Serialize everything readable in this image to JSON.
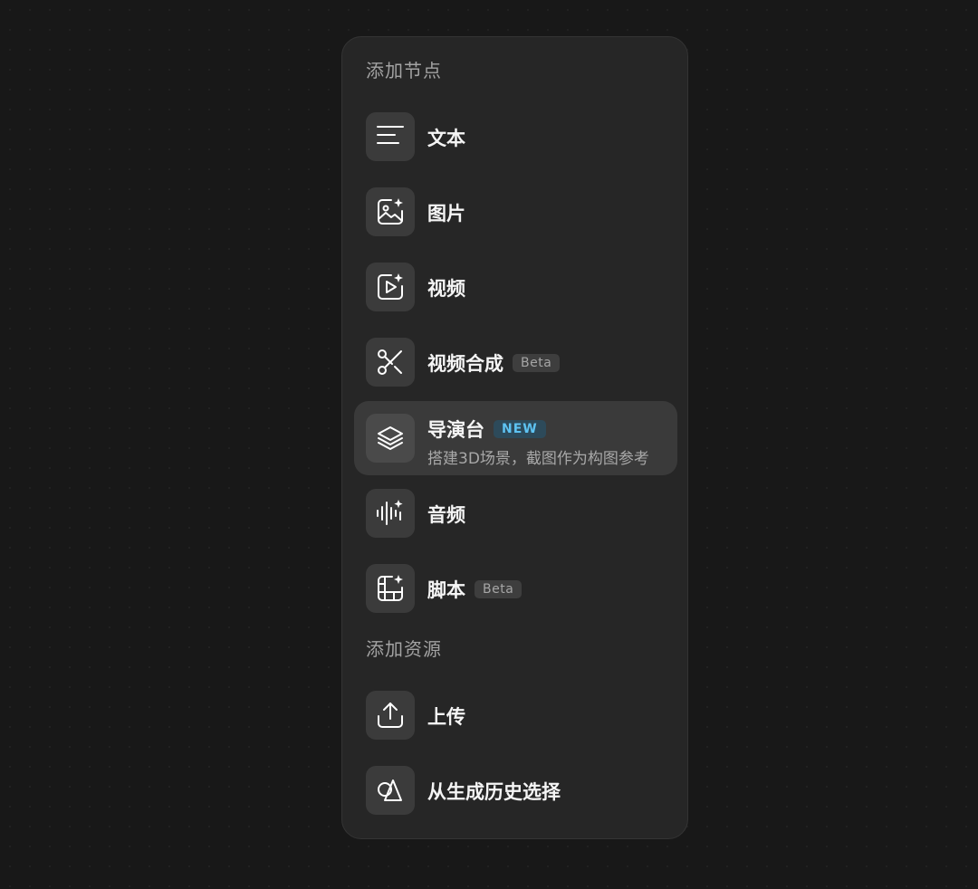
{
  "menu": {
    "nodes_section_title": "添加节点",
    "resources_section_title": "添加资源",
    "nodes": [
      {
        "label": "文本",
        "icon": "text-lines-icon"
      },
      {
        "label": "图片",
        "icon": "image-sparkle-icon"
      },
      {
        "label": "视频",
        "icon": "video-sparkle-icon"
      },
      {
        "label": "视频合成",
        "badge": "Beta",
        "icon": "scissors-icon"
      },
      {
        "label": "导演台",
        "badge": "NEW",
        "subtitle": "搭建3D场景，截图作为构图参考",
        "icon": "layers-icon"
      },
      {
        "label": "音频",
        "icon": "audio-wave-icon"
      },
      {
        "label": "脚本",
        "badge": "Beta",
        "icon": "storyboard-icon"
      }
    ],
    "resources": [
      {
        "label": "上传",
        "icon": "upload-icon"
      },
      {
        "label": "从生成历史选择",
        "icon": "shapes-icon"
      }
    ]
  },
  "colors": {
    "background": "#181818",
    "panel": "#262626",
    "active_item": "#3a3a3a",
    "new_badge_text": "#5ec3f2"
  }
}
